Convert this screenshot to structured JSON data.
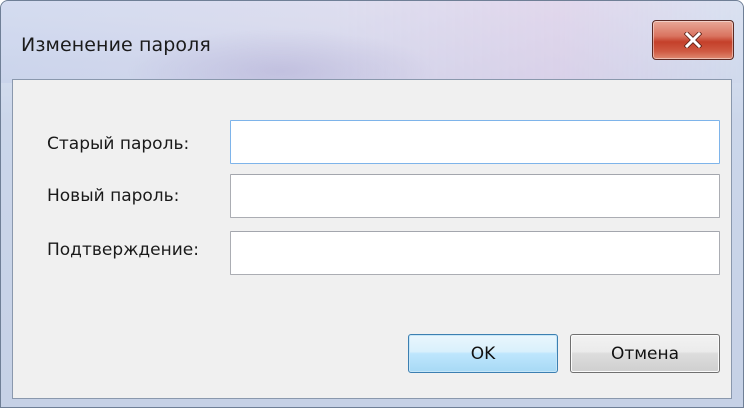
{
  "window": {
    "title": "Изменение пароля"
  },
  "icons": {
    "close": "close-icon"
  },
  "form": {
    "old_password": {
      "label": "Старый пароль:",
      "value": ""
    },
    "new_password": {
      "label": "Новый пароль:",
      "value": ""
    },
    "confirm": {
      "label": "Подтверждение:",
      "value": ""
    }
  },
  "buttons": {
    "ok_label": "OK",
    "cancel_label": "Отмена"
  },
  "colors": {
    "close_button": "#c4402a",
    "ok_button_border": "#3c7fb1",
    "focus_border": "#7eb4ea",
    "dialog_background": "#f0f0f0"
  }
}
